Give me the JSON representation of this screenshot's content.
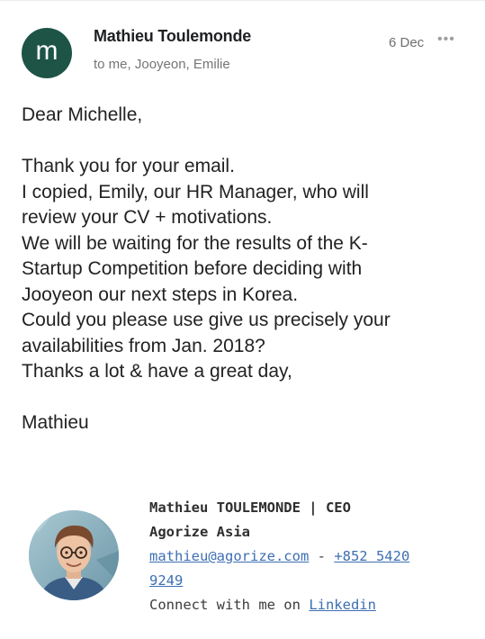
{
  "header": {
    "avatar_letter": "m",
    "avatar_color": "#1d5446",
    "sender": "Mathieu Toulemonde",
    "recipients": "to me, Jooyeon, Emilie",
    "date": "6 Dec",
    "more_icon": "more-horizontal-icon"
  },
  "message": {
    "greeting": "Dear Michelle,",
    "lines": [
      "Thank you for your email.",
      "I copied, Emily, our HR Manager, who will",
      "review your CV + motivations.",
      "We will be waiting for the results of the K-",
      "Startup Competition before deciding with",
      "Jooyeon our next steps in Korea.",
      "Could you please use give us precisely your",
      "availabilities from Jan. 2018?",
      "Thanks a lot & have a great day,"
    ],
    "signoff": "Mathieu"
  },
  "signature": {
    "name_title": "Mathieu TOULEMONDE | CEO",
    "company": "Agorize Asia",
    "email": "mathieu@agorize.com",
    "separator": " - ",
    "phone_part1": "+852 5420",
    "phone_part2": "9249",
    "connect_text": "Connect with me on ",
    "linkedin_text": "Linkedin",
    "link_color": "#3d6fb2"
  }
}
